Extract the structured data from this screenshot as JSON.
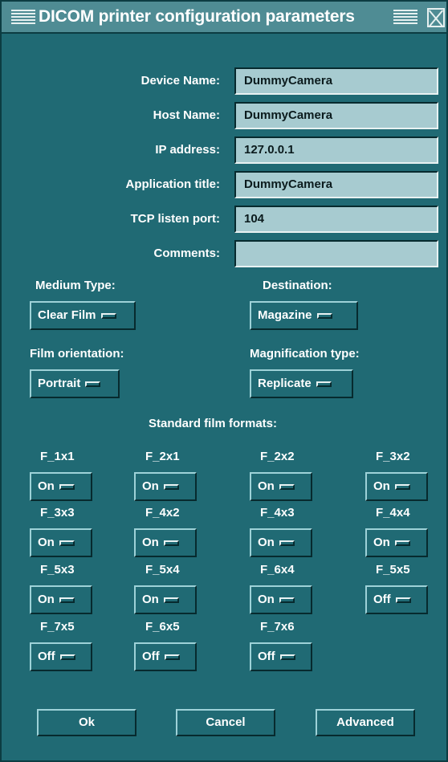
{
  "window": {
    "title": "DICOM printer configuration parameters"
  },
  "form": {
    "device_name": {
      "label": "Device Name:",
      "value": "DummyCamera"
    },
    "host_name": {
      "label": "Host Name:",
      "value": "DummyCamera"
    },
    "ip_address": {
      "label": "IP address:",
      "value": "127.0.0.1"
    },
    "application_title": {
      "label": "Application title:",
      "value": "DummyCamera"
    },
    "tcp_listen_port": {
      "label": "TCP listen port:",
      "value": "104"
    },
    "comments": {
      "label": "Comments:",
      "value": ""
    }
  },
  "options": {
    "medium_type": {
      "label": "Medium Type:",
      "value": "Clear Film"
    },
    "destination": {
      "label": "Destination:",
      "value": "Magazine"
    },
    "film_orientation": {
      "label": "Film orientation:",
      "value": "Portrait"
    },
    "magnification_type": {
      "label": "Magnification type:",
      "value": "Replicate"
    }
  },
  "formats": {
    "heading": "Standard film formats:",
    "items": [
      {
        "name": "F_1x1",
        "value": "On"
      },
      {
        "name": "F_2x1",
        "value": "On"
      },
      {
        "name": "F_2x2",
        "value": "On"
      },
      {
        "name": "F_3x2",
        "value": "On"
      },
      {
        "name": "F_3x3",
        "value": "On"
      },
      {
        "name": "F_4x2",
        "value": "On"
      },
      {
        "name": "F_4x3",
        "value": "On"
      },
      {
        "name": "F_4x4",
        "value": "On"
      },
      {
        "name": "F_5x3",
        "value": "On"
      },
      {
        "name": "F_5x4",
        "value": "On"
      },
      {
        "name": "F_6x4",
        "value": "On"
      },
      {
        "name": "F_5x5",
        "value": "Off"
      },
      {
        "name": "F_7x5",
        "value": "Off"
      },
      {
        "name": "F_6x5",
        "value": "Off"
      },
      {
        "name": "F_7x6",
        "value": "Off"
      }
    ]
  },
  "buttons": {
    "ok": "Ok",
    "cancel": "Cancel",
    "advanced": "Advanced"
  },
  "colors": {
    "background": "#206a74",
    "field": "#a7cbd0",
    "titlebar": "#4f8c94"
  }
}
